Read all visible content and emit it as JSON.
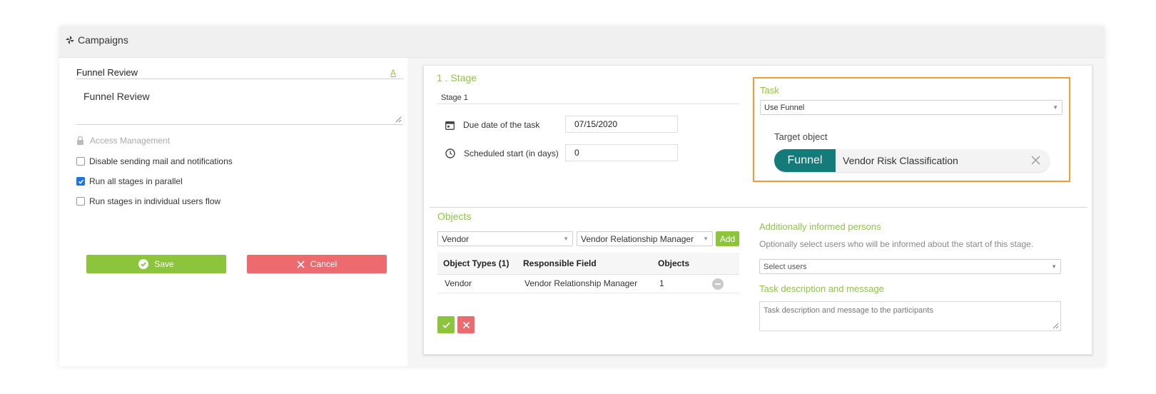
{
  "app": {
    "title": "Campaigns",
    "title_icon": "pinwheel-icon"
  },
  "left": {
    "name_value": "Funnel Review",
    "font_icon_label": "A",
    "description_value": "Funnel Review",
    "access_label": "Access Management",
    "options": [
      {
        "label": "Disable sending mail and notifications",
        "checked": false
      },
      {
        "label": "Run all stages in parallel",
        "checked": true
      },
      {
        "label": "Run stages in individual users flow",
        "checked": false
      }
    ],
    "save_label": "Save",
    "cancel_label": "Cancel"
  },
  "stage": {
    "title": "1 . Stage",
    "name_value": "Stage 1",
    "due_label": "Due date of the task",
    "due_value": "07/15/2020",
    "start_label": "Scheduled start (in days)",
    "start_value": "0"
  },
  "task": {
    "title": "Task",
    "type_value": "Use Funnel",
    "target_label": "Target object",
    "target_tag": "Funnel",
    "target_value": "Vendor Risk Classification"
  },
  "objects": {
    "title": "Objects",
    "type_select": "Vendor",
    "field_select": "Vendor Relationship Manager",
    "add_label": "Add",
    "columns": [
      "Object Types (1)",
      "Responsible Field",
      "Objects"
    ],
    "rows": [
      {
        "type": "Vendor",
        "field": "Vendor Relationship Manager",
        "count": "1"
      }
    ]
  },
  "informed": {
    "title": "Additionally informed persons",
    "help": "Optionally select users who will be informed about the start of this stage.",
    "select_placeholder": "Select users"
  },
  "message": {
    "title": "Task description and message",
    "placeholder": "Task description and message to the participants"
  },
  "colors": {
    "accent_green": "#8cc43c",
    "danger_red": "#ed6a6f",
    "highlight_orange": "#f39c34",
    "tag_teal": "#147a7a"
  }
}
